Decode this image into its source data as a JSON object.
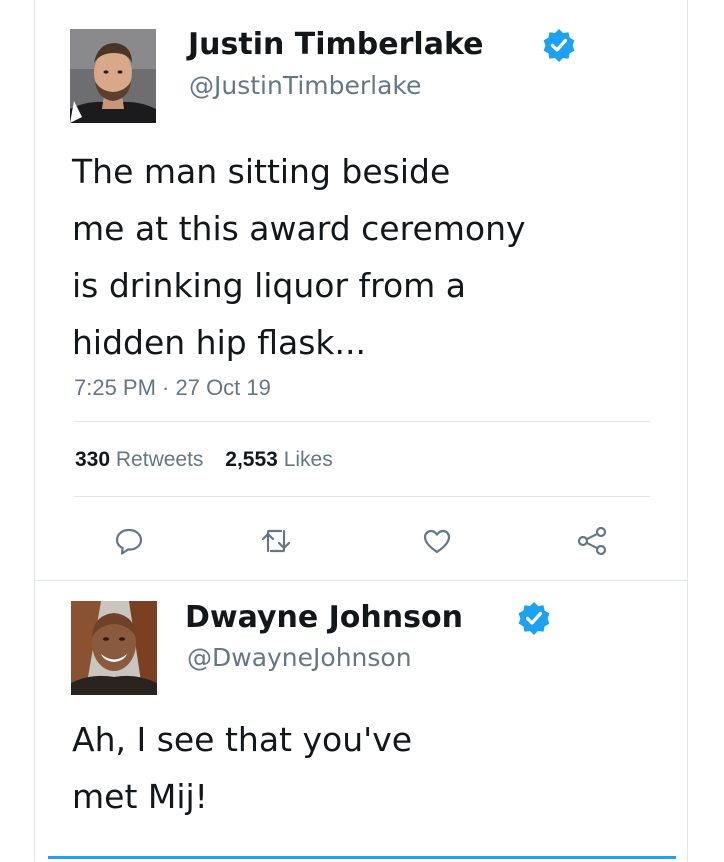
{
  "tweet": {
    "author": {
      "name": "Justin Timberlake",
      "handle": "@JustinTimberlake",
      "verified": true
    },
    "text_lines": [
      "The man sitting beside",
      "me at this award ceremony",
      "is drinking liquor from a",
      "hidden hip flask..."
    ],
    "timestamp": "7:25 PM · 27 Oct 19",
    "stats": {
      "retweets_count": "330",
      "retweets_label": "Retweets",
      "likes_count": "2,553",
      "likes_label": "Likes"
    },
    "actions": [
      "reply-icon",
      "retweet-icon",
      "like-icon",
      "share-icon"
    ]
  },
  "reply": {
    "author": {
      "name": "Dwayne Johnson",
      "handle": "@DwayneJohnson",
      "verified": true
    },
    "text_lines": [
      "Ah, I see that you've",
      "met Mij!"
    ]
  },
  "colors": {
    "text": "#14171a",
    "secondary": "#657786",
    "divider": "#e1e8ed",
    "verified": "#1da1f2",
    "accent": "#1da1f2"
  }
}
